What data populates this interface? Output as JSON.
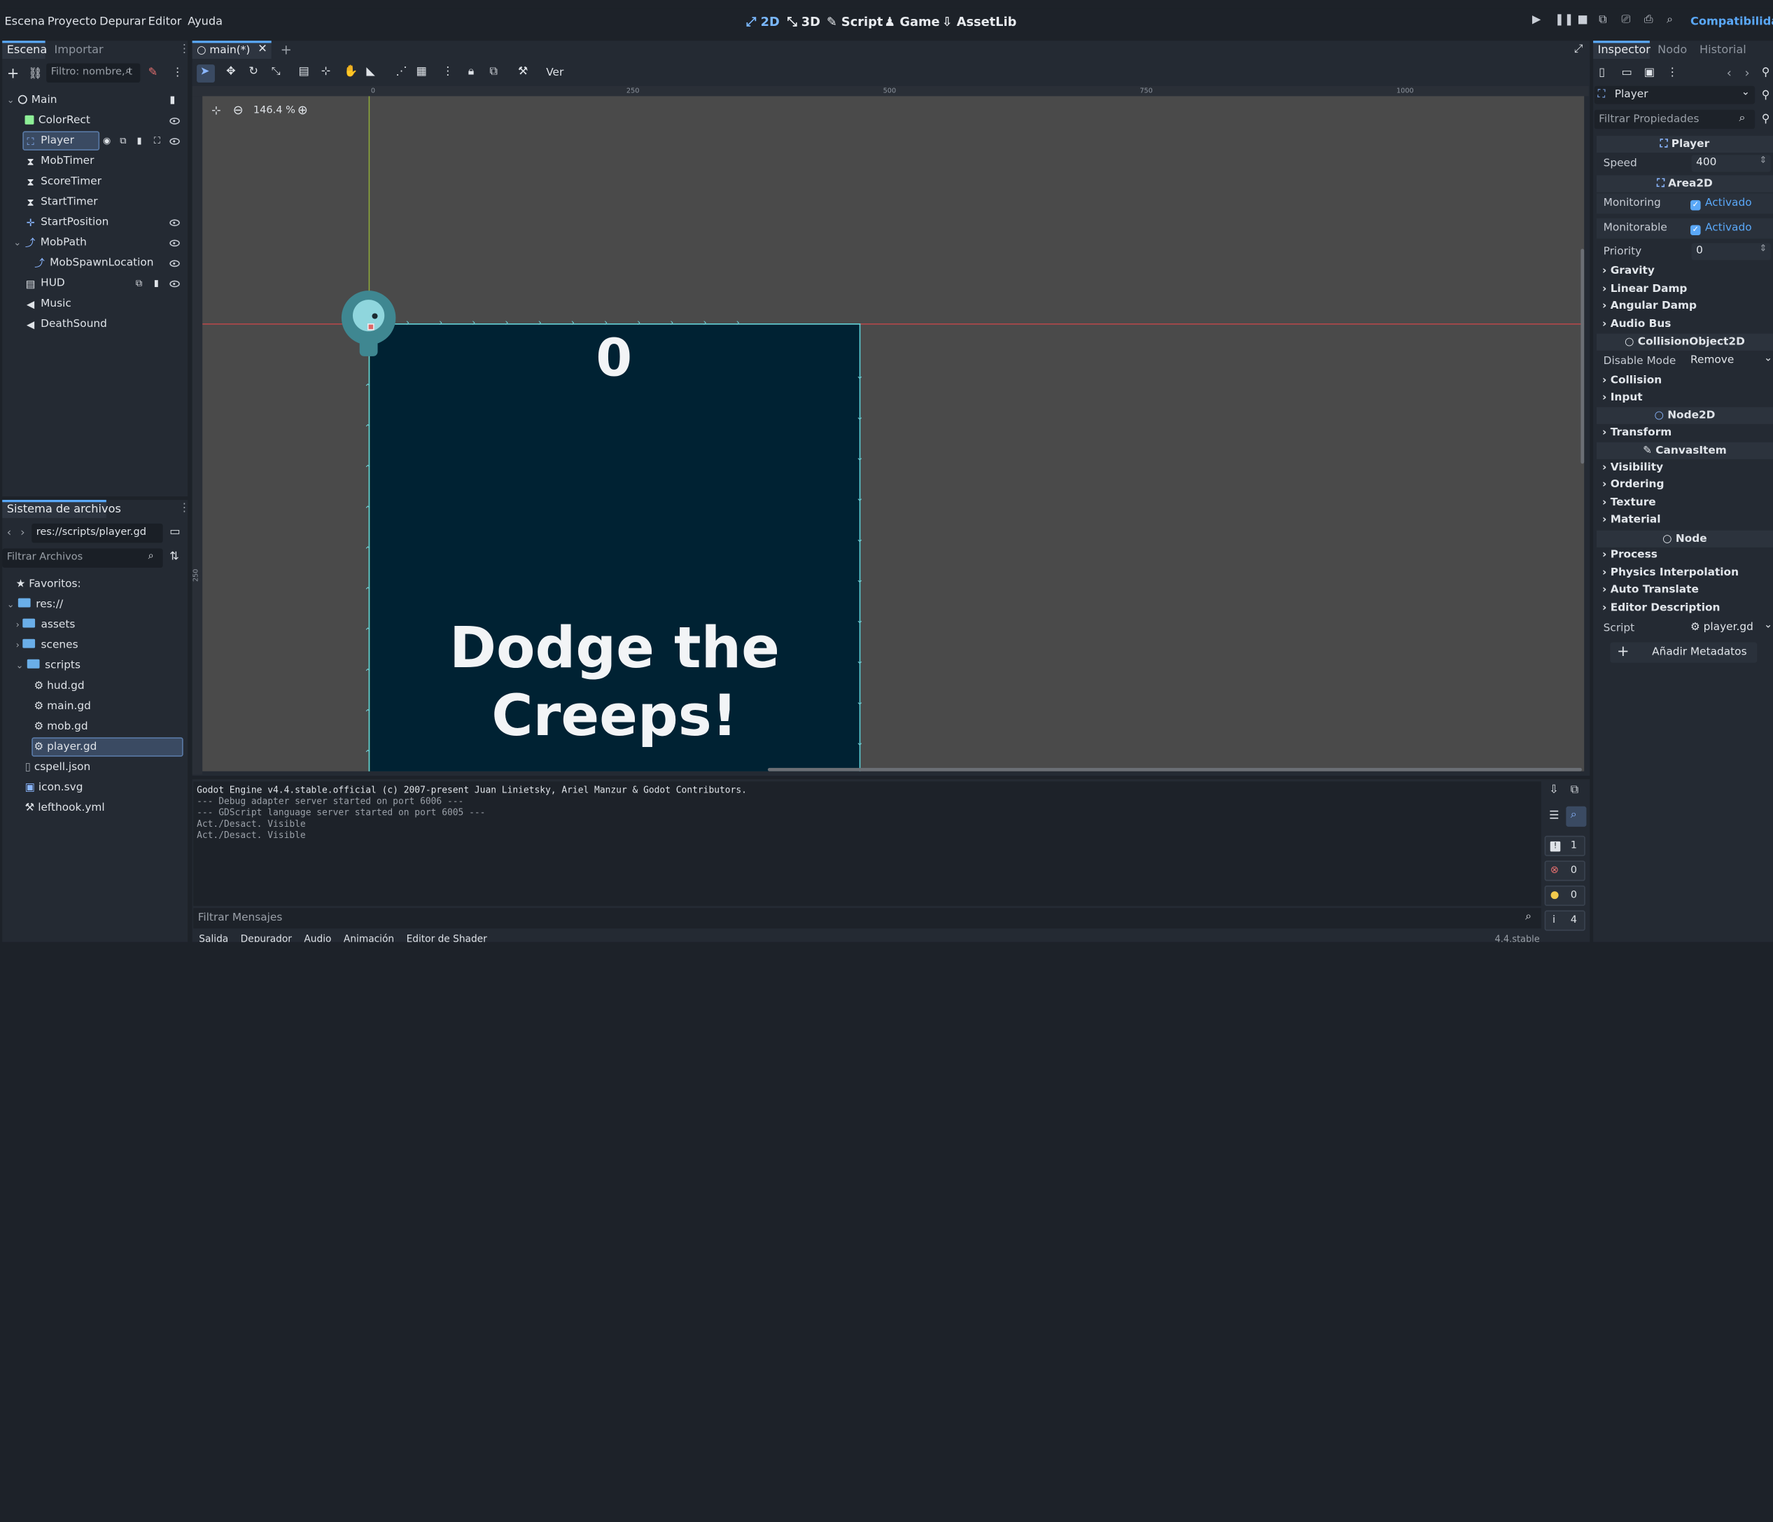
{
  "menu": [
    "Escena",
    "Proyecto",
    "Depurar",
    "Editor",
    "Ayuda"
  ],
  "workspaces": [
    {
      "label": "2D",
      "active": true
    },
    {
      "label": "3D",
      "active": false
    },
    {
      "label": "Script",
      "active": false
    },
    {
      "label": "Game",
      "active": false
    },
    {
      "label": "AssetLib",
      "active": false
    }
  ],
  "renderer": "Compatibilidad",
  "scene_dock": {
    "tabs": [
      "Escena",
      "Importar"
    ],
    "filter_placeholder": "Filtro: nombre, t",
    "nodes": [
      {
        "name": "Main",
        "icon": "node2d-icon",
        "depth": 0
      },
      {
        "name": "ColorRect",
        "icon": "colorrect-icon",
        "depth": 1
      },
      {
        "name": "Player",
        "icon": "area2d-icon",
        "depth": 1,
        "selected": true
      },
      {
        "name": "MobTimer",
        "icon": "timer-icon",
        "depth": 1
      },
      {
        "name": "ScoreTimer",
        "icon": "timer-icon",
        "depth": 1
      },
      {
        "name": "StartTimer",
        "icon": "timer-icon",
        "depth": 1
      },
      {
        "name": "StartPosition",
        "icon": "marker-icon",
        "depth": 1
      },
      {
        "name": "MobPath",
        "icon": "path-icon",
        "depth": 1
      },
      {
        "name": "MobSpawnLocation",
        "icon": "pathfollow-icon",
        "depth": 2
      },
      {
        "name": "HUD",
        "icon": "canvaslayer-icon",
        "depth": 1
      },
      {
        "name": "Music",
        "icon": "audio-icon",
        "depth": 1
      },
      {
        "name": "DeathSound",
        "icon": "audio-icon",
        "depth": 1
      }
    ]
  },
  "filesystem": {
    "title": "Sistema de archivos",
    "path": "res://scripts/player.gd",
    "filter_placeholder": "Filtrar Archivos",
    "favorites": "Favoritos:",
    "root": "res://",
    "items": [
      {
        "name": "assets",
        "type": "folder"
      },
      {
        "name": "scenes",
        "type": "folder"
      },
      {
        "name": "scripts",
        "type": "folder"
      },
      {
        "name": "hud.gd",
        "type": "script"
      },
      {
        "name": "main.gd",
        "type": "script"
      },
      {
        "name": "mob.gd",
        "type": "script"
      },
      {
        "name": "player.gd",
        "type": "script",
        "selected": true
      },
      {
        "name": "cspell.json",
        "type": "file"
      },
      {
        "name": "icon.svg",
        "type": "file"
      },
      {
        "name": "lefthook.yml",
        "type": "file"
      }
    ]
  },
  "editor": {
    "tab": "main(*)",
    "view_menu": "Ver",
    "zoom": "146.4 %",
    "ruler_labels": [
      "0",
      "250",
      "500",
      "750",
      "1000"
    ],
    "left_ruler_label": "250",
    "score_text": "0",
    "title_text_line1": "Dodge the",
    "title_text_line2": "Creeps!"
  },
  "output": {
    "lines": [
      "Godot Engine v4.4.stable.official (c) 2007-present Juan Linietsky, Ariel Manzur & Godot Contributors.",
      "--- Debug adapter server started on port 6006 ---",
      "--- GDScript language server started on port 6005 ---",
      "Act./Desact. Visible",
      "Act./Desact. Visible"
    ],
    "filter_placeholder": "Filtrar Mensajes",
    "counts": {
      "messages": "1",
      "errors": "0",
      "warnings": "0",
      "info": "4"
    },
    "bottom_tabs": [
      "Salida",
      "Depurador",
      "Audio",
      "Animación",
      "Editor de Shader"
    ],
    "bottom_status": "4.4.stable"
  },
  "inspector": {
    "tabs": [
      "Inspector",
      "Nodo",
      "Historial"
    ],
    "object": "Player",
    "filter_placeholder": "Filtrar Propiedades",
    "sections": {
      "player": "Player",
      "area2d": "Area2D",
      "collision_object": "CollisionObject2D",
      "node2d": "Node2D",
      "canvas_item": "CanvasItem",
      "node": "Node"
    },
    "speed_label": "Speed",
    "speed_value": "400",
    "monitoring_label": "Monitoring",
    "monitoring_value": "Activado",
    "monitorable_label": "Monitorable",
    "monitorable_value": "Activado",
    "priority_label": "Priority",
    "priority_value": "0",
    "groups_area": [
      "Gravity",
      "Linear Damp",
      "Angular Damp",
      "Audio Bus"
    ],
    "disable_mode_label": "Disable Mode",
    "disable_mode_value": "Remove",
    "groups_collision": [
      "Collision",
      "Input"
    ],
    "groups_node2d": [
      "Transform"
    ],
    "groups_canvas": [
      "Visibility",
      "Ordering",
      "Texture",
      "Material"
    ],
    "groups_node": [
      "Process",
      "Physics Interpolation",
      "Auto Translate",
      "Editor Description"
    ],
    "script_label": "Script",
    "script_value": "player.gd",
    "add_metadata": "Añadir Metadatos"
  },
  "colors": {
    "accent": "#5aa8f8",
    "game_bg": "#002233",
    "viewport_bg": "#4a4a4a"
  }
}
